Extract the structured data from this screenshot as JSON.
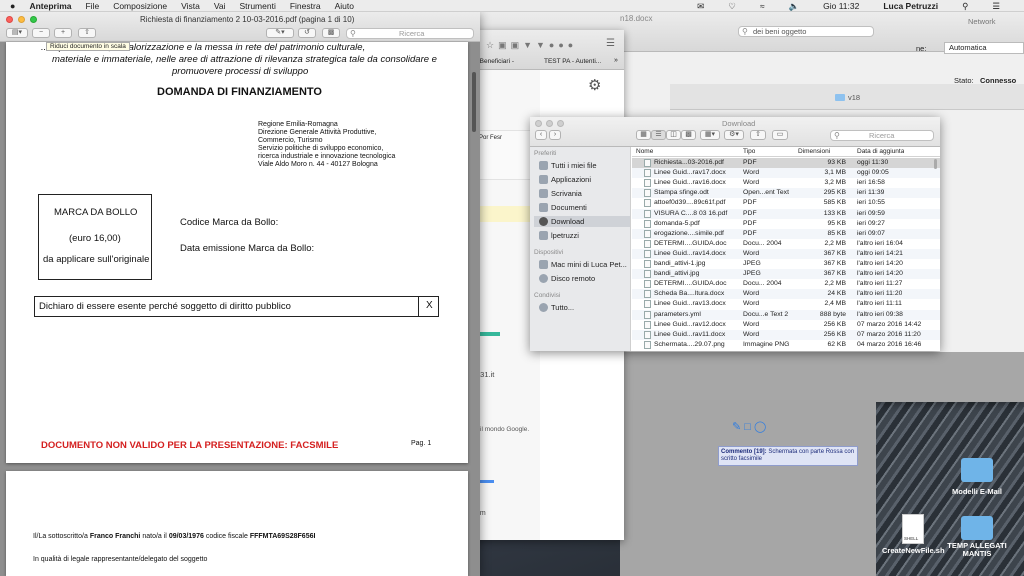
{
  "menubar": {
    "apple": "",
    "app": "Anteprima",
    "items": [
      "File",
      "Composizione",
      "Vista",
      "Vai",
      "Strumenti",
      "Finestra",
      "Aiuto"
    ],
    "clock": "Gio 11:32",
    "user": "Luca Petruzzi"
  },
  "preview": {
    "title": "Richiesta di finanziamento 2 10-03-2016.pdf (pagina 1 di 10)",
    "tooltip": "Riduci documento in scala",
    "search_placeholder": "Ricerca",
    "page1": {
      "intro_lines": [
        "... ti per la tutela, la valorizzazione e la messa in rete del patrimonio culturale,",
        "materiale e immateriale, nelle aree di attrazione di rilevanza strategica tale da consolidare e",
        "promuovere processi di sviluppo"
      ],
      "heading": "DOMANDA DI FINANZIAMENTO",
      "address": [
        "Regione Emilia-Romagna",
        "Direzione Generale Attività Produttive,",
        "Commercio, Turismo",
        "Servizio politiche di sviluppo economico,",
        "ricerca industriale e innovazione tecnologica",
        "Viale Aldo Moro n. 44 - 40127 Bologna"
      ],
      "stamp_title": "MARCA DA BOLLO",
      "stamp_amount": "(euro 16,00)",
      "stamp_note": "da applicare sull'originale",
      "stamp_code_label": "Codice Marca da Bollo:",
      "stamp_date_label": "Data emissione Marca da Bollo:",
      "exempt_text": "Dichiaro di essere esente perché soggetto di diritto pubblico",
      "exempt_mark": "X",
      "invalid_notice": "DOCUMENTO NON VALIDO PER LA PRESENTAZIONE: FACSMILE",
      "page_number": "Pag. 1"
    },
    "page2": {
      "sig_prefix": "Il/La sottoscritto/a",
      "sig_name": "Franco Franchi",
      "sig_born": "nato/a  il",
      "sig_date": "09/03/1976",
      "sig_cf_label": "codice fiscale",
      "sig_cf": "FFFMTA69S28F656I",
      "role_line": "In qualità di legale rappresentante/delegato del soggetto"
    }
  },
  "browser": {
    "bookmarks": [
      "T Beneficiari -",
      "TEST PA - Autenti..."
    ],
    "search_placeholder": "Ricerca",
    "content_fragments": [
      "Por Fesr",
      "a31.it",
      "il mondo Google.",
      "om"
    ]
  },
  "background": {
    "doc_title": "n18.docx",
    "search_value": "dei beni oggetto",
    "field_label": "ne:",
    "field_value": "Automatica",
    "status_label": "Stato:",
    "status_value": "Connesso",
    "network_title": "Network",
    "folder_name": "v18",
    "comment_label": "Commento [19]:",
    "comment_text": "Schermata con parte Rossa con scritto facsimile"
  },
  "finder": {
    "title": "Download",
    "search_placeholder": "Ricerca",
    "sidebar": {
      "favorites_header": "Preferiti",
      "favorites": [
        "Tutti i miei file",
        "Applicazioni",
        "Scrivania",
        "Documenti",
        "Download",
        "lpetruzzi"
      ],
      "devices_header": "Dispositivi",
      "devices": [
        "Mac mini di Luca Pet...",
        "Disco remoto"
      ],
      "shared_header": "Condivisi",
      "shared": [
        "Tutto..."
      ]
    },
    "columns": [
      "Nome",
      "Tipo",
      "Dimensioni",
      "Data di aggiunta"
    ],
    "rows": [
      [
        "Richiesta...03-2016.pdf",
        "PDF",
        "93 KB",
        "oggi 11:30"
      ],
      [
        "Linee Guid...rav17.docx",
        "Word",
        "3,1 MB",
        "oggi 09:05"
      ],
      [
        "Linee Guid...rav16.docx",
        "Word",
        "3,2 MB",
        "ieri 16:58"
      ],
      [
        "Stampa sfinge.odt",
        "Open...ent Text",
        "295 KB",
        "ieri 11:39"
      ],
      [
        "attoef0d39....89c61f.pdf",
        "PDF",
        "585 KB",
        "ieri 10:55"
      ],
      [
        "VISURA C....8 03 16.pdf",
        "PDF",
        "133 KB",
        "ieri 09:59"
      ],
      [
        "domanda-5.pdf",
        "PDF",
        "95 KB",
        "ieri 09:27"
      ],
      [
        "erogazione....simile.pdf",
        "PDF",
        "85 KB",
        "ieri 09:07"
      ],
      [
        "DETERMI....GUIDA.doc",
        "Docu... 2004",
        "2,2 MB",
        "l'altro ieri 16:04"
      ],
      [
        "Linee Guid...rav14.docx",
        "Word",
        "367 KB",
        "l'altro ieri 14:21"
      ],
      [
        "bandi_attivi-1.jpg",
        "JPEG",
        "367 KB",
        "l'altro ieri 14:20"
      ],
      [
        "bandi_attivi.jpg",
        "JPEG",
        "367 KB",
        "l'altro ieri 14:20"
      ],
      [
        "DETERMI....GUIDA.doc",
        "Docu... 2004",
        "2,2 MB",
        "l'altro ieri 11:27"
      ],
      [
        "Scheda Ba....ltura.docx",
        "Word",
        "24 KB",
        "l'altro ieri 11:20"
      ],
      [
        "Linee Guid...rav13.docx",
        "Word",
        "2,4 MB",
        "l'altro ieri 11:11"
      ],
      [
        "parameters.yml",
        "Docu...e Text 2",
        "888 byte",
        "l'altro ieri 09:38"
      ],
      [
        "Linee Guid...rav12.docx",
        "Word",
        "256 KB",
        "07 marzo 2016 14:42"
      ],
      [
        "Linee Guid...rav11.docx",
        "Word",
        "256 KB",
        "07 marzo 2016 11:20"
      ],
      [
        "Schermata....29.07.png",
        "Immagine PNG",
        "62 KB",
        "04 marzo 2016 16:46"
      ]
    ]
  },
  "desktop_icons": [
    {
      "label": "Modelli E-Mail"
    },
    {
      "label": "TEMP ALLEGATI MANTIS"
    },
    {
      "label": "CreateNewFile.sh",
      "badge": "SHELL"
    }
  ]
}
